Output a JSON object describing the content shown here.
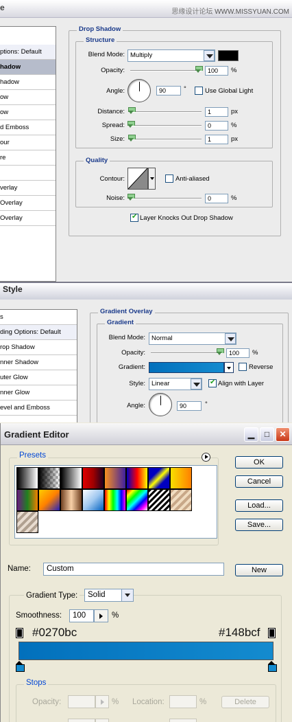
{
  "watermark": {
    "cn": "思缘设计论坛",
    "url": "WWW.MISSYUAN.COM"
  },
  "panel1": {
    "style_list": [
      "ptions: Default",
      "hadow",
      "hadow",
      "ow",
      "ow",
      "d Emboss",
      "our",
      "re",
      "",
      "verlay",
      "Overlay",
      "Overlay"
    ],
    "section_title": "Drop Shadow",
    "structure": {
      "title": "Structure",
      "blend_mode_label": "Blend Mode:",
      "blend_mode_value": "Multiply",
      "blend_color": "#000000",
      "opacity_label": "Opacity:",
      "opacity_value": "100",
      "opacity_fraction": 1.0,
      "opacity_unit": "%",
      "angle_label": "Angle:",
      "angle_value": "90",
      "angle_unit": "°",
      "use_global_light_label": "Use Global Light",
      "use_global_light": false,
      "distance_label": "Distance:",
      "distance_value": "1",
      "distance_unit": "px",
      "spread_label": "Spread:",
      "spread_value": "0",
      "spread_unit": "%",
      "size_label": "Size:",
      "size_value": "1",
      "size_unit": "px"
    },
    "quality": {
      "title": "Quality",
      "contour_label": "Contour:",
      "anti_aliased_label": "Anti-aliased",
      "anti_aliased": false,
      "noise_label": "Noise:",
      "noise_value": "0",
      "noise_unit": "%"
    },
    "layer_knocks_out_label": "Layer Knocks Out Drop Shadow",
    "layer_knocks_out": true
  },
  "panel2": {
    "window_title": "Style",
    "style_list": [
      "s",
      "ding Options: Default",
      "rop Shadow",
      "nner Shadow",
      "uter Glow",
      "nner Glow",
      "evel and Emboss"
    ],
    "section_title": "Gradient Overlay",
    "gradient_group_title": "Gradient",
    "blend_mode_label": "Blend Mode:",
    "blend_mode_value": "Normal",
    "opacity_label": "Opacity:",
    "opacity_value": "100",
    "opacity_unit": "%",
    "gradient_label": "Gradient:",
    "reverse_label": "Reverse",
    "reverse": false,
    "style_label": "Style:",
    "style_value": "Linear",
    "align_label": "Align with Layer",
    "align": true,
    "angle_label": "Angle:",
    "angle_value": "90",
    "angle_unit": "°"
  },
  "gradient_editor": {
    "title": "Gradient Editor",
    "presets_label": "Presets",
    "ok_label": "OK",
    "cancel_label": "Cancel",
    "load_label": "Load...",
    "save_label": "Save...",
    "name_label": "Name:",
    "name_value": "Custom",
    "new_label": "New",
    "gradient_type_label": "Gradient Type:",
    "gradient_type_value": "Solid",
    "smoothness_label": "Smoothness:",
    "smoothness_value": "100",
    "smoothness_unit": "%",
    "left_color_label": "#0270bc",
    "right_color_label": "#148bcf",
    "left_color": "#0270bc",
    "right_color": "#148bcf",
    "stops_label": "Stops",
    "stop_opacity_label": "Opacity:",
    "stop_opacity_unit": "%",
    "stop_location_label": "Location:",
    "stop_location_unit": "%",
    "delete_label": "Delete"
  }
}
